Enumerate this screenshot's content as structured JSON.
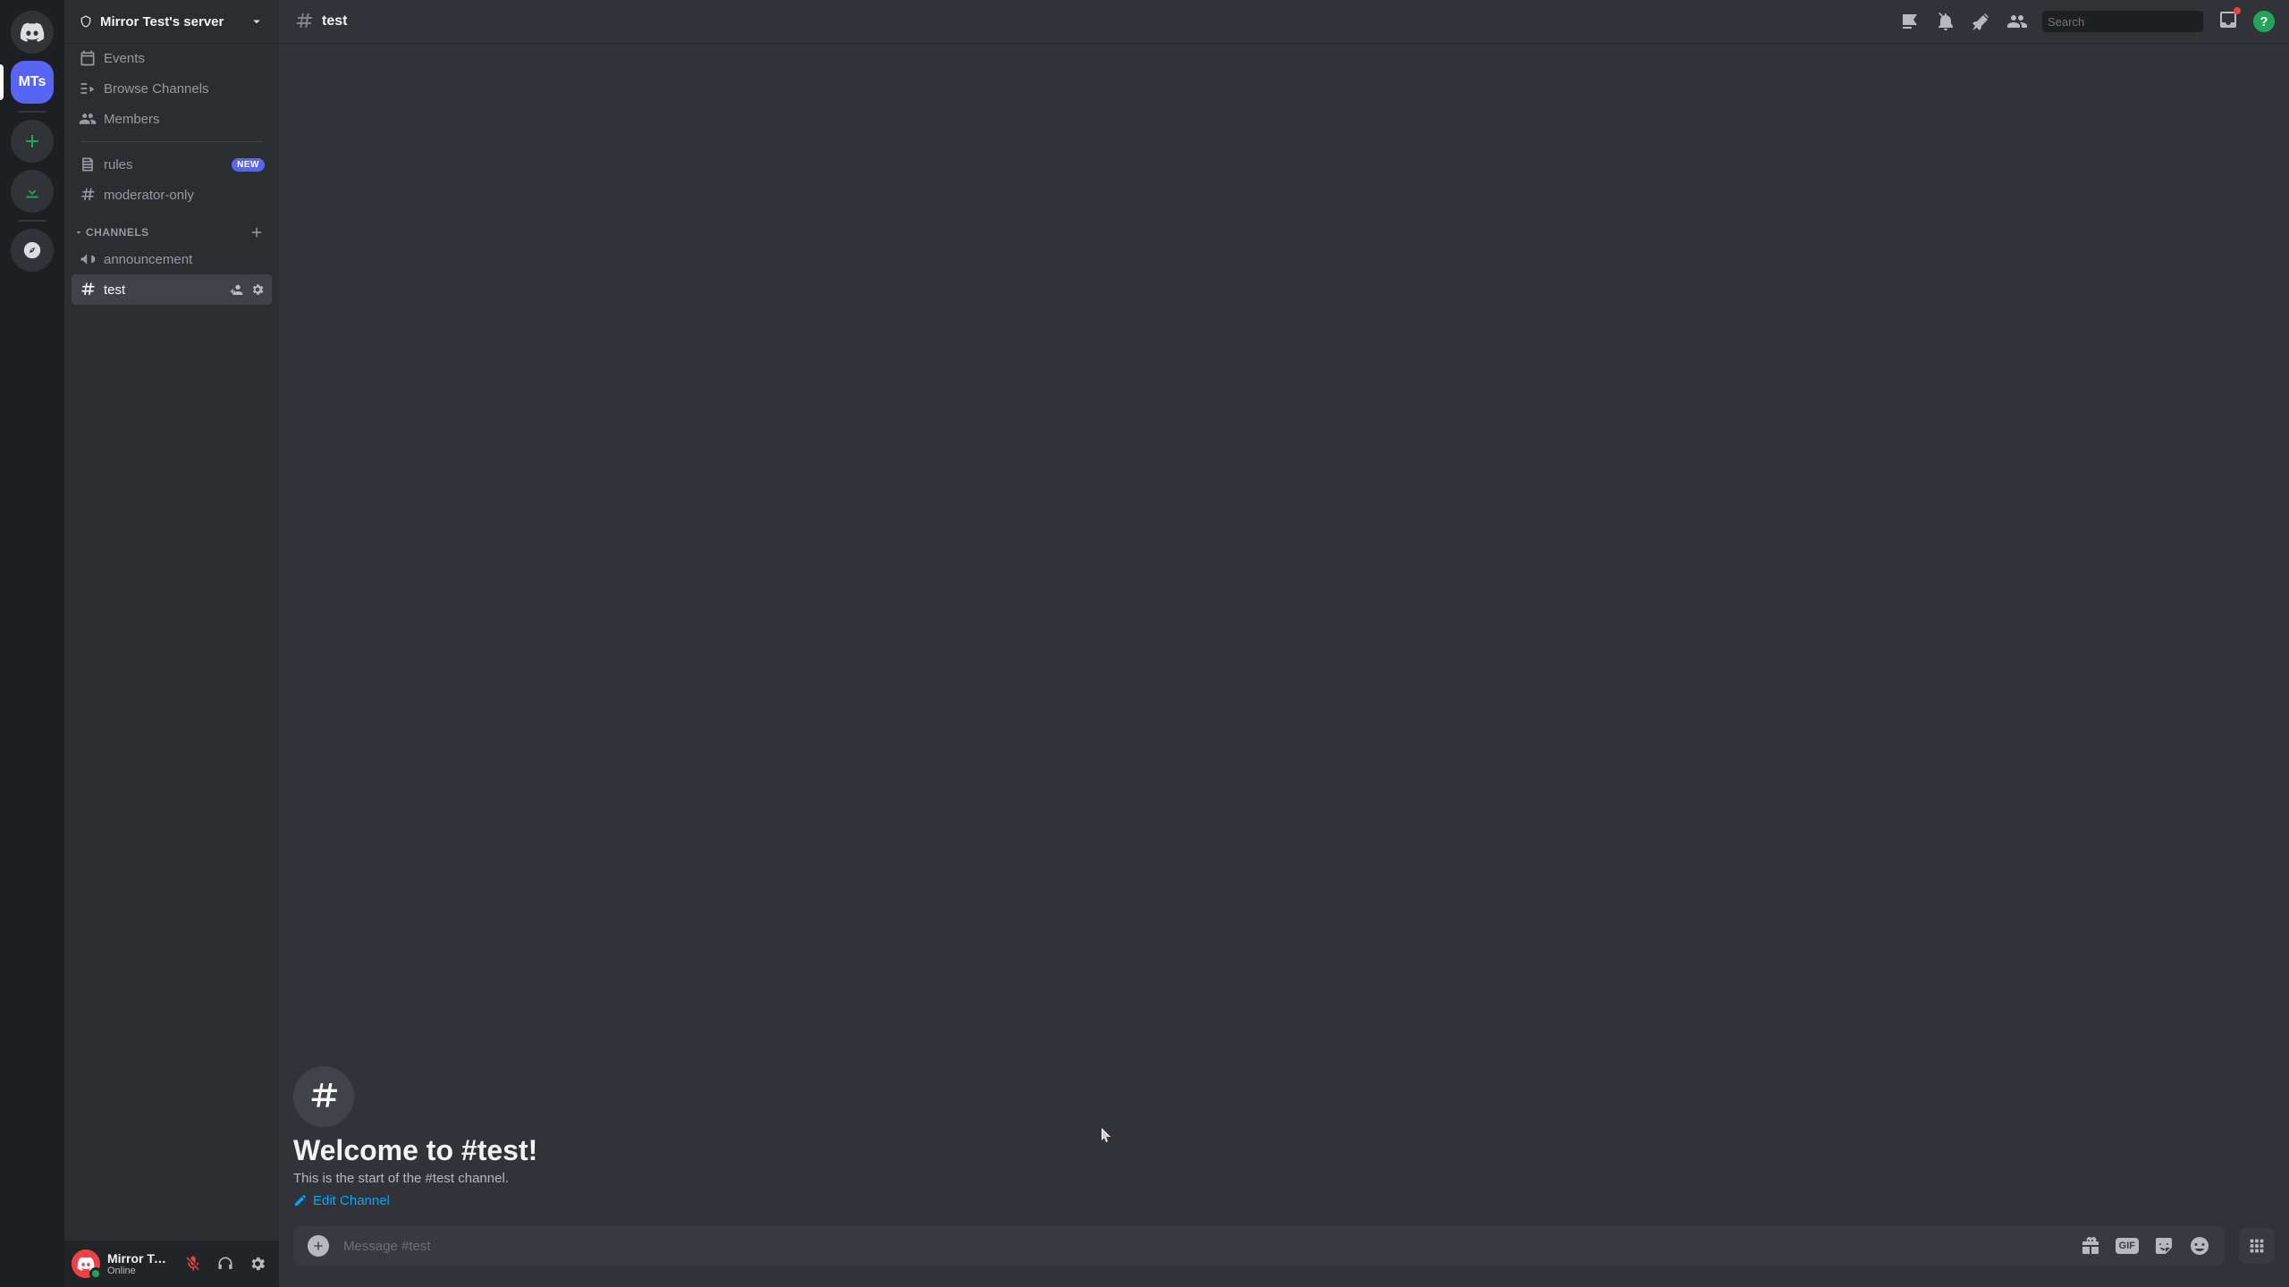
{
  "server_rail": {
    "server_initials": "MTs"
  },
  "sidebar": {
    "server_name": "Mirror Test's server",
    "top_items": [
      {
        "label": "Events"
      },
      {
        "label": "Browse Channels"
      },
      {
        "label": "Members"
      }
    ],
    "pinned_channels": [
      {
        "label": "rules",
        "badge": "NEW"
      },
      {
        "label": "moderator-only"
      }
    ],
    "category": "CHANNELS",
    "channels": [
      {
        "label": "announcement"
      },
      {
        "label": "test",
        "active": true
      }
    ]
  },
  "user_panel": {
    "username": "Mirror Test",
    "status": "Online"
  },
  "chat": {
    "channel_name": "test",
    "welcome_title": "Welcome to #test!",
    "welcome_subtitle": "This is the start of the #test channel.",
    "edit_link": "Edit Channel",
    "composer_placeholder": "Message #test"
  },
  "search": {
    "placeholder": "Search"
  }
}
